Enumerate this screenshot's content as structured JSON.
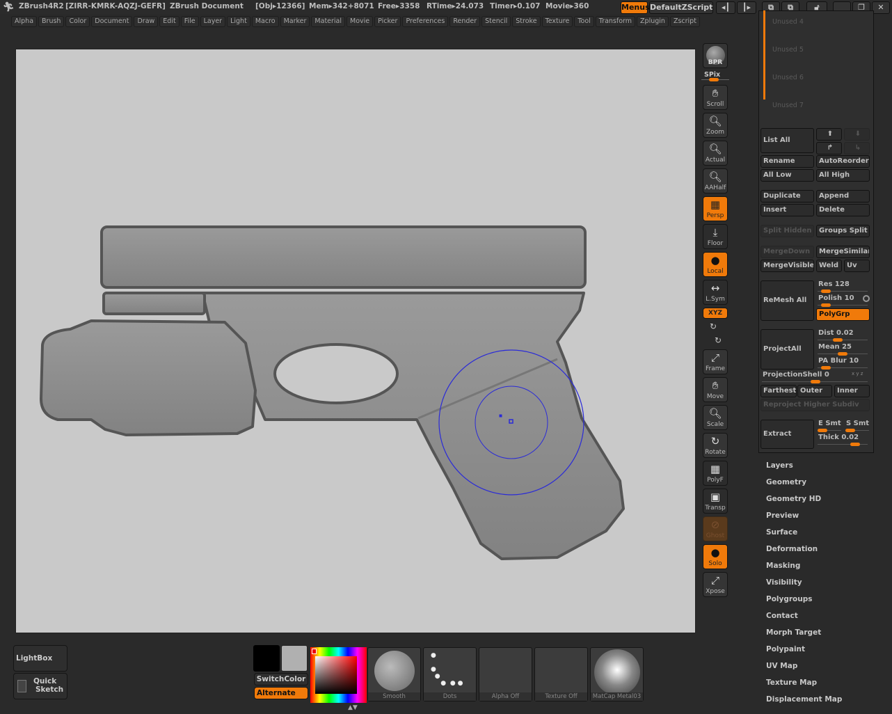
{
  "title": {
    "app": "ZBrush4R2",
    "serial": "[ZIRR-KMRK-AQZJ-GEFR]",
    "document": "ZBrush Document",
    "obj": "[Obj▸12366]",
    "mem": "Mem▸342+8071",
    "free": "Free▸3358",
    "rtime": "RTime▸24.073",
    "timer": "Timer▸0.107",
    "movie": "Movie▸360",
    "menus_btn": "Menus",
    "script_btn": "DefaultZScript"
  },
  "menubar": [
    "Alpha",
    "Brush",
    "Color",
    "Document",
    "Draw",
    "Edit",
    "File",
    "Layer",
    "Light",
    "Macro",
    "Marker",
    "Material",
    "Movie",
    "Picker",
    "Preferences",
    "Render",
    "Stencil",
    "Stroke",
    "Texture",
    "Tool",
    "Transform",
    "Zplugin",
    "Zscript"
  ],
  "toolbar": {
    "bpr": "BPR",
    "spix": "SPix",
    "scroll": "Scroll",
    "zoom": "Zoom",
    "actual": "Actual",
    "aahalf": "AAHalf",
    "persp": "Persp",
    "floor": "Floor",
    "local": "Local",
    "lsym": "L.Sym",
    "xyz": "XYZ",
    "frame": "Frame",
    "move": "Move",
    "scale": "Scale",
    "rotate": "Rotate",
    "polyf": "PolyF",
    "transp": "Transp",
    "ghost": "Ghost",
    "solo": "Solo",
    "xpose": "Xpose"
  },
  "subtool": {
    "unused": [
      "Unused 4",
      "Unused 5",
      "Unused 6",
      "Unused 7"
    ],
    "list_all": "List All",
    "rename": "Rename",
    "autoreorder": "AutoReorder",
    "all_low": "All Low",
    "all_high": "All High",
    "duplicate": "Duplicate",
    "append": "Append",
    "insert": "Insert",
    "delete": "Delete",
    "split_hidden": "Split Hidden",
    "groups_split": "Groups Split",
    "merge_down": "MergeDown",
    "merge_similar": "MergeSimilar",
    "merge_visible": "MergeVisible",
    "weld": "Weld",
    "uv": "Uv",
    "remesh_all": "ReMesh All",
    "res": "Res 128",
    "polish": "Polish 10",
    "polygrp": "PolyGrp",
    "project_all": "ProjectAll",
    "dist": "Dist 0.02",
    "mean": "Mean 25",
    "pa_blur": "PA Blur 10",
    "projection_shell": "ProjectionShell 0",
    "farthest": "Farthest",
    "outer": "Outer",
    "inner": "Inner",
    "reproject": "Reproject Higher Subdiv",
    "extract": "Extract",
    "e_smt": "E Smt",
    "s_smt": "S Smt",
    "thick": "Thick 0.02"
  },
  "tool_menus": [
    "Layers",
    "Geometry",
    "Geometry HD",
    "Preview",
    "Surface",
    "Deformation",
    "Masking",
    "Visibility",
    "Polygroups",
    "Contact",
    "Morph Target",
    "Polypaint",
    "UV Map",
    "Texture Map",
    "Displacement Map"
  ],
  "bottom": {
    "lightbox": "LightBox",
    "quick": "Quick",
    "sketch": "Sketch",
    "switch_color": "SwitchColor",
    "alternate": "Alternate",
    "brush": "Smooth",
    "stroke": "Dots",
    "alpha": "Alpha Off",
    "texture": "Texture Off",
    "material": "MatCap Metal03"
  },
  "colors": {
    "accent": "#f07a0a",
    "primary_color": "#000000",
    "secondary_color": "#b0b0b0",
    "brush_cursor": "#2a2ad8"
  }
}
